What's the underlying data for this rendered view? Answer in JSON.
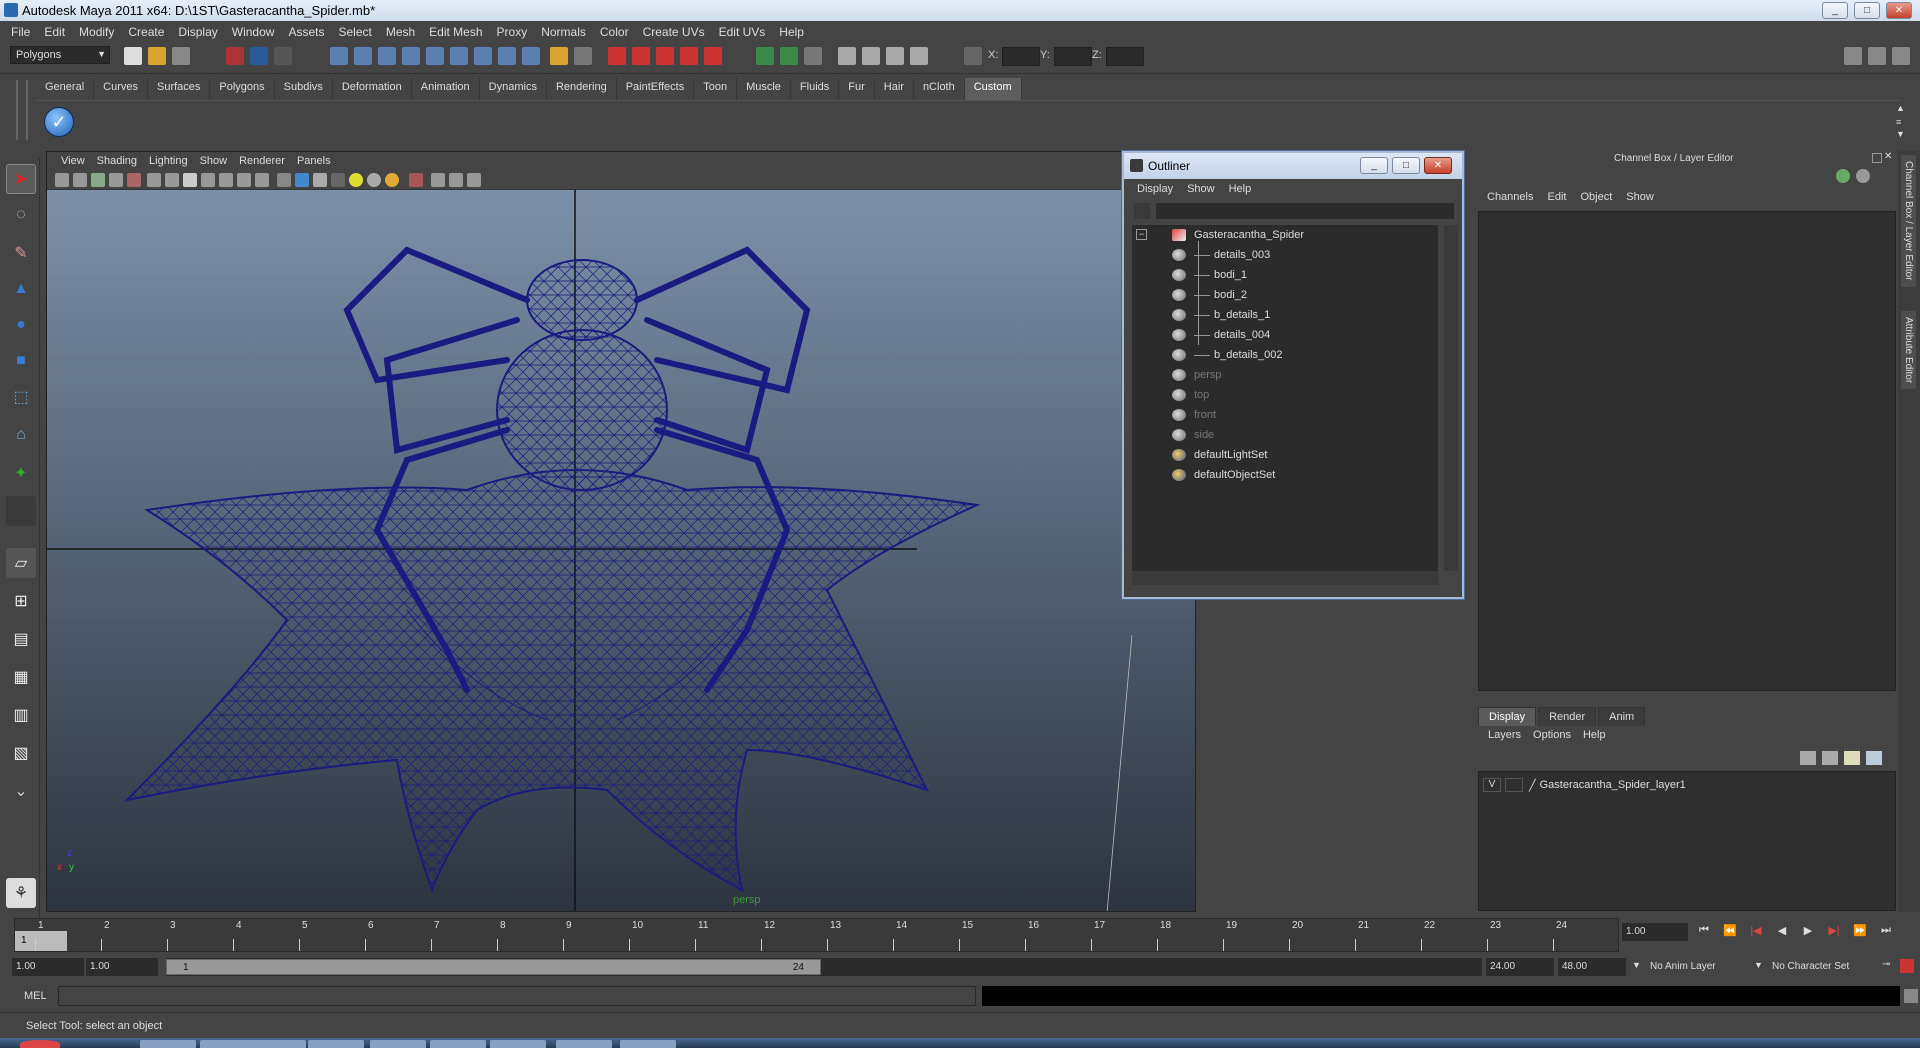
{
  "window": {
    "title": "Autodesk Maya 2011 x64: D:\\1ST\\Gasteracantha_Spider.mb*"
  },
  "menus": [
    "File",
    "Edit",
    "Modify",
    "Create",
    "Display",
    "Window",
    "Assets",
    "Select",
    "Mesh",
    "Edit Mesh",
    "Proxy",
    "Normals",
    "Color",
    "Create UVs",
    "Edit UVs",
    "Help"
  ],
  "status_line": {
    "mode": "Polygons",
    "x_label": "X:",
    "y_label": "Y:",
    "z_label": "Z:"
  },
  "shelf": {
    "tabs": [
      "General",
      "Curves",
      "Surfaces",
      "Polygons",
      "Subdivs",
      "Deformation",
      "Animation",
      "Dynamics",
      "Rendering",
      "PaintEffects",
      "Toon",
      "Muscle",
      "Fluids",
      "Fur",
      "Hair",
      "nCloth",
      "Custom"
    ],
    "active": "Custom"
  },
  "viewport": {
    "menu": [
      "View",
      "Shading",
      "Lighting",
      "Show",
      "Renderer",
      "Panels"
    ],
    "camera_label": "persp",
    "axis_x": "x",
    "axis_y": "y",
    "axis_z": "z",
    "wire_color": "#1a1a80"
  },
  "outliner": {
    "title": "Outliner",
    "menu": [
      "Display",
      "Show",
      "Help"
    ],
    "collapse_glyph": "−",
    "root": "Gasteracantha_Spider",
    "children": [
      "details_003",
      "bodi_1",
      "bodi_2",
      "b_details_1",
      "details_004",
      "b_details_002"
    ],
    "cameras": [
      "persp",
      "top",
      "front",
      "side"
    ],
    "sets": [
      "defaultLightSet",
      "defaultObjectSet"
    ]
  },
  "channel_box": {
    "title": "Channel Box / Layer Editor",
    "menu": [
      "Channels",
      "Edit",
      "Object",
      "Show"
    ]
  },
  "layer_editor": {
    "tabs": [
      "Display",
      "Render",
      "Anim"
    ],
    "active_tab": "Display",
    "menu": [
      "Layers",
      "Options",
      "Help"
    ],
    "layers": [
      {
        "visible": "V",
        "name": "Gasteracantha_Spider_layer1"
      }
    ]
  },
  "side_tabs": [
    "Channel Box / Layer Editor",
    "Attribute Editor"
  ],
  "time_slider": {
    "ticks": [
      "1",
      "2",
      "3",
      "4",
      "5",
      "6",
      "7",
      "8",
      "9",
      "10",
      "11",
      "12",
      "13",
      "14",
      "15",
      "16",
      "17",
      "18",
      "19",
      "20",
      "21",
      "22",
      "23",
      "24"
    ],
    "current_frame": "1",
    "current_time": "1.00"
  },
  "range_slider": {
    "start": "1.00",
    "playback_start": "1.00",
    "slider_start_label": "1",
    "slider_end_label": "24",
    "playback_end": "24.00",
    "end": "48.00",
    "anim_layer": "No Anim Layer",
    "character_set": "No Character Set"
  },
  "command_line": {
    "label": "MEL"
  },
  "help_line": "Select Tool: select an object"
}
